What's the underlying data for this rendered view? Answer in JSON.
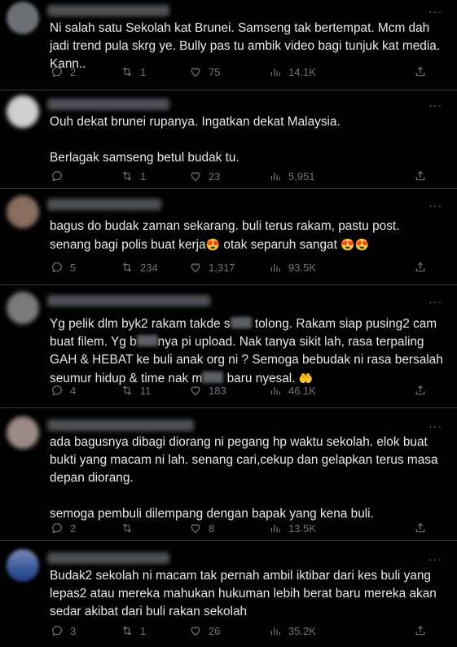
{
  "replies": [
    {
      "lines": [
        "Ni salah satu Sekolah kat Brunei. Samseng tak bertempat. Mcm dah jadi trend pula skrg ye. Bully pas tu ambik video bagi tunjuk kat media. Kann.."
      ],
      "replies_count": "2",
      "retweets": "1",
      "likes": "75",
      "views": "14.1K",
      "avatar_color": "#6b6f73"
    },
    {
      "lines": [
        "Ouh dekat brunei rupanya. Ingatkan dekat Malaysia.",
        "Berlagak samseng betul budak tu."
      ],
      "replies_count": "",
      "retweets": "1",
      "likes": "23",
      "views": "5,951",
      "avatar_color": "#cfcfcf"
    },
    {
      "line_a": "bagus do budak zaman sekarang. buli terus rakam, pastu post. senang bagi polis buat kerja",
      "line_b": " otak separuh sangat ",
      "replies_count": "5",
      "retweets": "234",
      "likes": "1,317",
      "views": "93.5K",
      "avatar_color": "#8a6f60"
    },
    {
      "part1": "Yg pelik dlm byk2 rakam takde s",
      "part2": " tolong. Rakam siap pusing2 cam buat filem. Yg b",
      "part3": "nya pi upload. Nak tanya sikit lah, rasa terpaling GAH & HEBAT ke buli anak org ni ? Semoga bebudak ni rasa bersalah seumur hidup & time nak m",
      "part4": " baru nyesal. ",
      "replies_count": "4",
      "retweets": "11",
      "likes": "183",
      "views": "46.1K",
      "avatar_color": "#7a7a7a"
    },
    {
      "lines": [
        "ada bagusnya dibagi diorang ni pegang hp waktu sekolah. elok buat bukti yang macam ni lah. senang cari,cekup dan gelapkan terus masa depan diorang.",
        "semoga pembuli dilempang dengan bapak yang kena buli."
      ],
      "replies_count": "2",
      "retweets": "",
      "likes": "8",
      "views": "13.5K",
      "avatar_color": "#9b8a86"
    },
    {
      "lines": [
        "Budak2 sekolah ni macam tak pernah ambil iktibar dari kes buli yang lepas2 atau mereka mahukan hukuman lebih berat baru mereka akan sedar akibat dari buli rakan sekolah"
      ],
      "replies_count": "3",
      "retweets": "1",
      "likes": "26",
      "views": "35.2K",
      "avatar_color": "#3a5a9a"
    }
  ],
  "emoji": {
    "heart_eyes": "😍",
    "palms": "🤲"
  },
  "more_label": "···"
}
